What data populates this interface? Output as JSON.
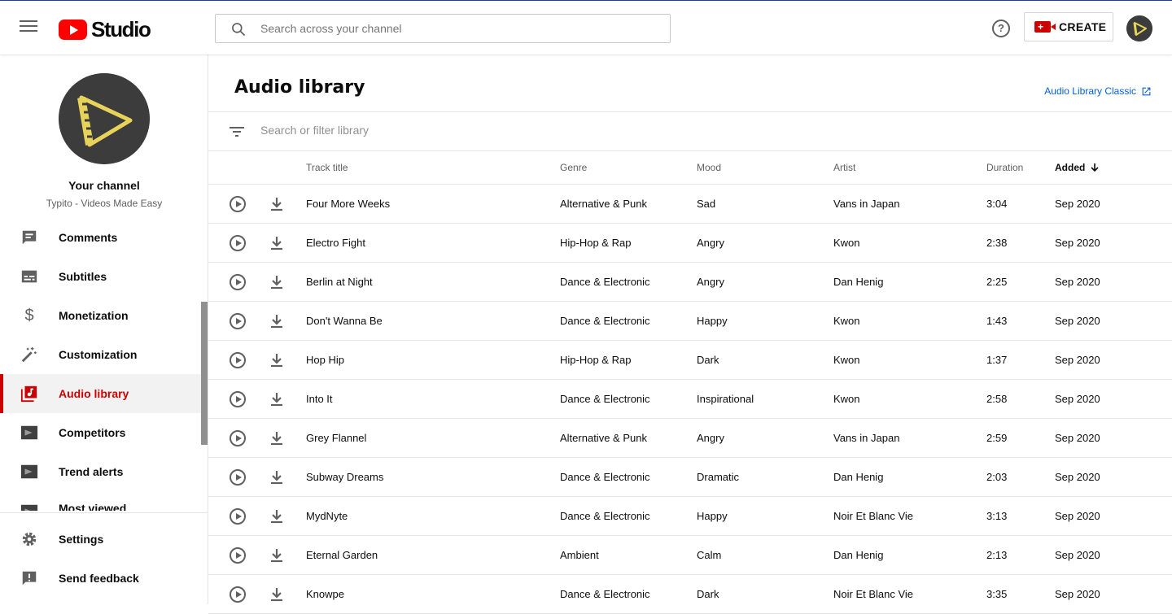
{
  "header": {
    "logo_text": "Studio",
    "search_placeholder": "Search across your channel",
    "help_glyph": "?",
    "create_label": "CREATE"
  },
  "sidebar": {
    "channel_name": "Your channel",
    "channel_subtitle": "Typito - Videos Made Easy",
    "items": [
      {
        "label": "Comments",
        "icon": "comments-icon"
      },
      {
        "label": "Subtitles",
        "icon": "subtitles-icon"
      },
      {
        "label": "Monetization",
        "icon": "dollar-icon"
      },
      {
        "label": "Customization",
        "icon": "magic-wand-icon"
      },
      {
        "label": "Audio library",
        "icon": "audio-library-icon",
        "active": true
      },
      {
        "label": "Competitors",
        "icon": "plugin-icon"
      },
      {
        "label": "Trend alerts",
        "icon": "plugin-icon"
      },
      {
        "label": "Most viewed",
        "icon": "plugin-icon"
      }
    ],
    "bottom_items": [
      {
        "label": "Settings",
        "icon": "gear-icon"
      },
      {
        "label": "Send feedback",
        "icon": "feedback-icon"
      }
    ]
  },
  "main": {
    "title": "Audio library",
    "classic_link": "Audio Library Classic",
    "filter_placeholder": "Search or filter library",
    "columns": {
      "title": "Track title",
      "genre": "Genre",
      "mood": "Mood",
      "artist": "Artist",
      "duration": "Duration",
      "added": "Added"
    },
    "tracks": [
      {
        "title": "Four More Weeks",
        "genre": "Alternative & Punk",
        "mood": "Sad",
        "artist": "Vans in Japan",
        "duration": "3:04",
        "added": "Sep 2020"
      },
      {
        "title": "Electro Fight",
        "genre": "Hip-Hop & Rap",
        "mood": "Angry",
        "artist": "Kwon",
        "duration": "2:38",
        "added": "Sep 2020"
      },
      {
        "title": "Berlin at Night",
        "genre": "Dance & Electronic",
        "mood": "Angry",
        "artist": "Dan Henig",
        "duration": "2:25",
        "added": "Sep 2020"
      },
      {
        "title": "Don't Wanna Be",
        "genre": "Dance & Electronic",
        "mood": "Happy",
        "artist": "Kwon",
        "duration": "1:43",
        "added": "Sep 2020"
      },
      {
        "title": "Hop Hip",
        "genre": "Hip-Hop & Rap",
        "mood": "Dark",
        "artist": "Kwon",
        "duration": "1:37",
        "added": "Sep 2020"
      },
      {
        "title": "Into It",
        "genre": "Dance & Electronic",
        "mood": "Inspirational",
        "artist": "Kwon",
        "duration": "2:58",
        "added": "Sep 2020"
      },
      {
        "title": "Grey Flannel",
        "genre": "Alternative & Punk",
        "mood": "Angry",
        "artist": "Vans in Japan",
        "duration": "2:59",
        "added": "Sep 2020"
      },
      {
        "title": "Subway Dreams",
        "genre": "Dance & Electronic",
        "mood": "Dramatic",
        "artist": "Dan Henig",
        "duration": "2:03",
        "added": "Sep 2020"
      },
      {
        "title": "MydNyte",
        "genre": "Dance & Electronic",
        "mood": "Happy",
        "artist": "Noir Et Blanc Vie",
        "duration": "3:13",
        "added": "Sep 2020"
      },
      {
        "title": "Eternal Garden",
        "genre": "Ambient",
        "mood": "Calm",
        "artist": "Dan Henig",
        "duration": "2:13",
        "added": "Sep 2020"
      },
      {
        "title": "Knowpe",
        "genre": "Dance & Electronic",
        "mood": "Dark",
        "artist": "Noir Et Blanc Vie",
        "duration": "3:35",
        "added": "Sep 2020"
      }
    ]
  },
  "colors": {
    "brand_red": "#ff0000",
    "active_red": "#cc0000",
    "link_blue": "#065fd4",
    "logo_yellow": "#e8d35a"
  }
}
